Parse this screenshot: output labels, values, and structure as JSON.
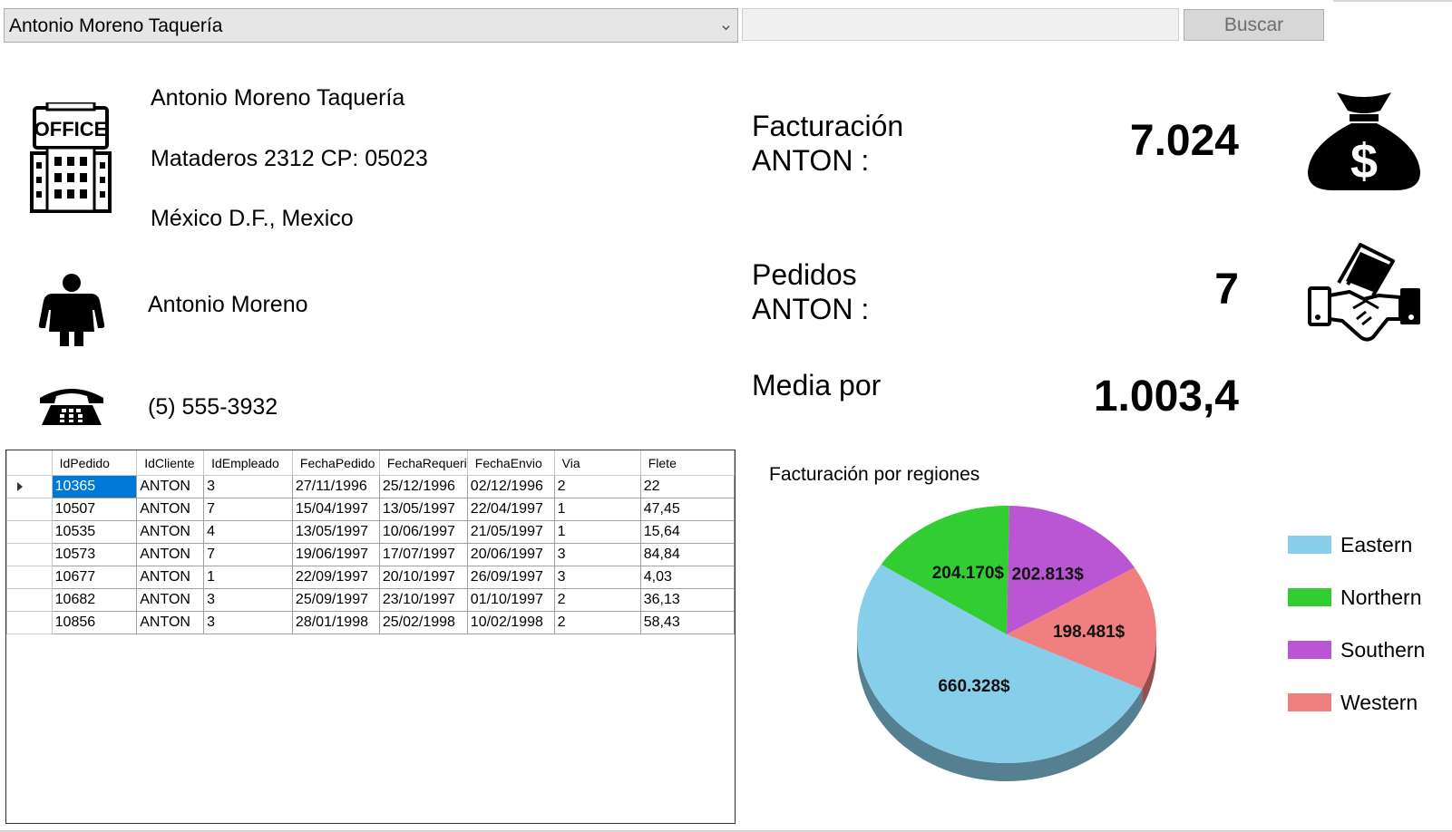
{
  "header": {
    "customer_select": "Antonio Moreno Taquería",
    "search_value": "",
    "search_button": "Buscar"
  },
  "customer": {
    "company": "Antonio Moreno Taquería",
    "address": "Mataderos  2312 CP: 05023",
    "city": "México D.F., Mexico",
    "contact": "Antonio Moreno",
    "phone": "(5) 555-3932"
  },
  "kpis": {
    "billing_label_1": "Facturación",
    "billing_label_2": "ANTON :",
    "billing_value": "7.024",
    "orders_label_1": "Pedidos",
    "orders_label_2": "ANTON :",
    "orders_value": "7",
    "avg_label": "Media por",
    "avg_value": "1.003,4"
  },
  "icons": {
    "building": "office-building-icon",
    "person": "person-icon",
    "phone": "telephone-icon",
    "money": "money-bag-icon",
    "deal": "handshake-icon"
  },
  "grid": {
    "columns": [
      "IdPedido",
      "IdCliente",
      "IdEmpleado",
      "FechaPedido",
      "FechaRequeri",
      "FechaEnvio",
      "Via",
      "Flete"
    ],
    "rows": [
      [
        "10365",
        "ANTON",
        "3",
        "27/11/1996",
        "25/12/1996",
        "02/12/1996",
        "2",
        "22"
      ],
      [
        "10507",
        "ANTON",
        "7",
        "15/04/1997",
        "13/05/1997",
        "22/04/1997",
        "1",
        "47,45"
      ],
      [
        "10535",
        "ANTON",
        "4",
        "13/05/1997",
        "10/06/1997",
        "21/05/1997",
        "1",
        "15,64"
      ],
      [
        "10573",
        "ANTON",
        "7",
        "19/06/1997",
        "17/07/1997",
        "20/06/1997",
        "3",
        "84,84"
      ],
      [
        "10677",
        "ANTON",
        "1",
        "22/09/1997",
        "20/10/1997",
        "26/09/1997",
        "3",
        "4,03"
      ],
      [
        "10682",
        "ANTON",
        "3",
        "25/09/1997",
        "23/10/1997",
        "01/10/1997",
        "2",
        "36,13"
      ],
      [
        "10856",
        "ANTON",
        "3",
        "28/01/1998",
        "25/02/1998",
        "10/02/1998",
        "2",
        "58,43"
      ]
    ],
    "selected_row": 0
  },
  "chart_data": {
    "type": "pie",
    "title": "Facturación por regiones",
    "categories": [
      "Eastern",
      "Northern",
      "Southern",
      "Western"
    ],
    "values": [
      660328,
      204170,
      202813,
      198481
    ],
    "labels": [
      "660.328$",
      "204.170$",
      "202.813$",
      "198.481$"
    ],
    "colors": [
      "#87ceeb",
      "#32cd32",
      "#ba55d3",
      "#f08080"
    ],
    "legend": "right"
  }
}
